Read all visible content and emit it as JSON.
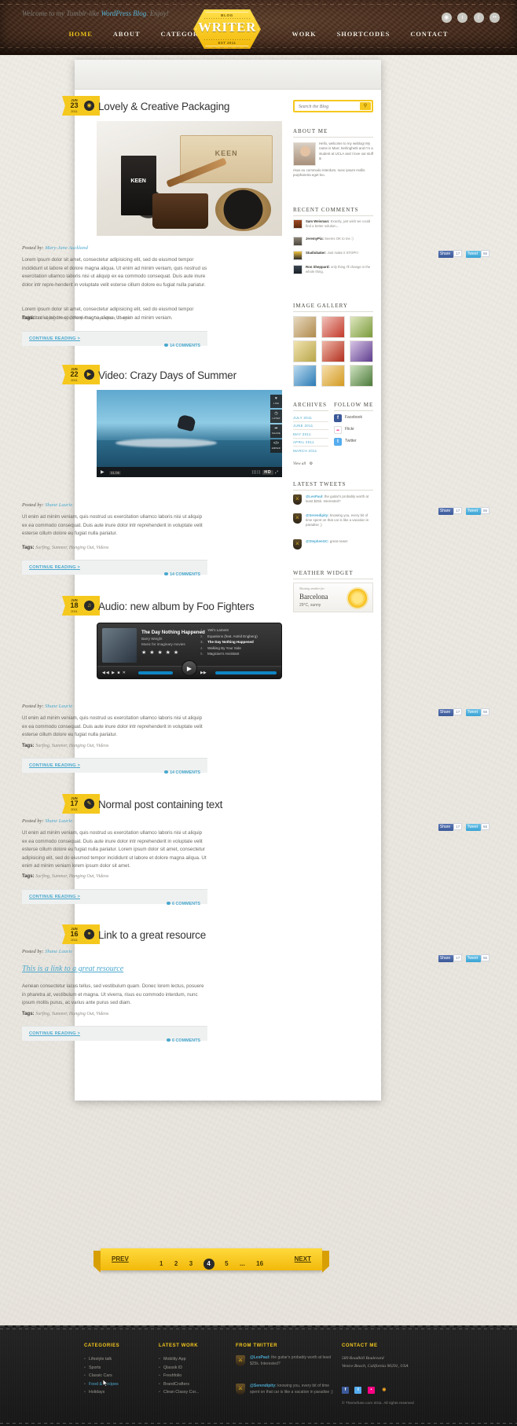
{
  "site": {
    "logo_top": "BLOG",
    "logo_word": "WRITER",
    "logo_est": "EST 2011"
  },
  "nav": {
    "left": [
      {
        "label": "HOME",
        "active": true
      },
      {
        "label": "ABOUT",
        "active": false
      },
      {
        "label": "CATEGORIES",
        "active": false
      }
    ],
    "right": [
      {
        "label": "WORK",
        "active": false
      },
      {
        "label": "SHORTCODES",
        "active": false
      },
      {
        "label": "CONTACT",
        "active": false
      }
    ]
  },
  "welcome": {
    "prefix": "Welcome to my Tumblr-like ",
    "link": "WordPress Blog",
    "suffix": ". Enjoy!",
    "social": [
      {
        "name": "rss-icon",
        "glyph": "◉"
      },
      {
        "name": "twitter-icon",
        "glyph": "t"
      },
      {
        "name": "facebook-icon",
        "glyph": "f"
      },
      {
        "name": "flickr-icon",
        "glyph": "••"
      }
    ]
  },
  "posts": [
    {
      "date": {
        "month": "JUN",
        "day": "23",
        "year": "2011"
      },
      "type_icon": "camera-icon",
      "type_glyph": "◉",
      "title": "Lovely & Creative Packaging",
      "byline_label": "Posted by:",
      "author": "Mary-Jane Auckland",
      "share": {
        "fb": "Share",
        "fb_count": "17",
        "tw": "Tweet",
        "tw_count": "56"
      },
      "paragraphs": [
        "Lorem ipsum dolor sit amet, consectetur adipisicing elit, sed do eiusmod tempor incididunt ut labore et dolore magna aliqua. Ut enim ad minim veniam, quis nostrud us exercitation ullamco laboris nisi ut aliquip ex ea commodo consequat. Duis aute inure dolor intr repre-henderit in voluptate velit esterse cillum dolore eu fugiat nulla pariatur.",
        "Lorem ipsum dolor sit amet, consectetur adipisicing elit, sed do eiusmod tempor incididunt ut labore et dolore magna aliqua. Ut enim ad minim veniam."
      ],
      "tags_label": "Tags:",
      "tags": "Packaging Design,  Portfolios,  Inspiration, Images",
      "continue": "CONTINUE READING >",
      "comments": "14 COMMENTS"
    },
    {
      "date": {
        "month": "JUN",
        "day": "22",
        "year": "2011"
      },
      "type_icon": "video-icon",
      "type_glyph": "▶",
      "title": "Video: Crazy Days of Summer",
      "byline_label": "Posted by:",
      "author": "Shane Laurie",
      "share": {
        "fb": "Share",
        "fb_count": "17",
        "tw": "Tweet",
        "tw_count": "56"
      },
      "video": {
        "time": "01:09",
        "hd": "HD",
        "buttons": [
          {
            "label": "LIKE",
            "glyph": "♥"
          },
          {
            "label": "LATER",
            "glyph": "◷"
          },
          {
            "label": "SHARE",
            "glyph": "➦"
          },
          {
            "label": "EMBED",
            "glyph": "</>"
          }
        ]
      },
      "paragraphs": [
        "Ut enim ad minim veniam, quis nostrud us exercitation ullamco laboris nisi ut aliquip ex ea commodo consequat. Duis aute inure dolor intr reprehenderit in voluptate velit esterse cillum dolore eu fugiat nulla pariatur."
      ],
      "tags_label": "Tags:",
      "tags": "Surfing,  Summer,  Hanging Out, Videos",
      "continue": "CONTINUE READING >",
      "comments": "14 COMMENTS"
    },
    {
      "date": {
        "month": "JUN",
        "day": "18",
        "year": "2011"
      },
      "type_icon": "audio-icon",
      "type_glyph": "♫",
      "title": "Audio: new album by Foo Fighters",
      "byline_label": "Posted by:",
      "author": "Shane Laurie",
      "share": {
        "fb": "Share",
        "fb_count": "17",
        "tw": "Tweet",
        "tw_count": "56"
      },
      "audio": {
        "track_title": "The Day Nothing Happened",
        "artist": "Barry Weight",
        "album": "Music for imaginary movies",
        "stars": "★ ★ ★ ★ ★",
        "transport": "◀◀  ▶  ■  ✕",
        "tracklist": [
          {
            "n": "1.",
            "name": "Yeti's Lament",
            "current": false
          },
          {
            "n": "2.",
            "name": "Equations (feat. Astrid Engberg)",
            "current": false
          },
          {
            "n": "3.",
            "name": "The Day Nothing Happened",
            "current": true
          },
          {
            "n": "4.",
            "name": "Walking By Your Side",
            "current": false
          },
          {
            "n": "5.",
            "name": "Magician's Assistant",
            "current": false
          }
        ]
      },
      "paragraphs": [
        "Ut enim ad minim veniam, quis nostrud us exercitation ullamco laboris nisi ut aliquip ex ea commodo consequat. Duis aute inure dolor intr reprehenderit in voluptate velit esterse cillum dolore eu fugiat nulla pariatur."
      ],
      "tags_label": "Tags:",
      "tags": "Surfing,  Summer,  Hanging Out, Videos",
      "continue": "CONTINUE READING >",
      "comments": "14 COMMENTS"
    },
    {
      "date": {
        "month": "JUN",
        "day": "17",
        "year": "2011"
      },
      "type_icon": "text-icon",
      "type_glyph": "✎",
      "title": "Normal post containing text",
      "byline_label": "Posted by:",
      "author": "Shane Laurie",
      "share": {
        "fb": "Share",
        "fb_count": "17",
        "tw": "Tweet",
        "tw_count": "56"
      },
      "paragraphs": [
        "Ut enim ad minim veniam, quis nostrud us exercitation ullamco laboris nisi ut aliquip ex ea commodo consequat. Duis aute inure dolor intr reprehenderit in voluptate velit esterse cillum dolore eu fugiat nulla pariatur. Lorem ipsum dolor sit amet, consectetur adipisicing elit, sed do eiusmod tempor incididunt ut labore et dolore magna aliqua. Ut enim ad minim veniam lorem ipsum dolor sit amet."
      ],
      "tags_label": "Tags:",
      "tags": "Surfing,  Summer,  Hanging Out, Videos",
      "continue": "CONTINUE READING >",
      "comments": "6 COMMENTS"
    },
    {
      "date": {
        "month": "JUN",
        "day": "16",
        "year": "2011"
      },
      "type_icon": "link-icon",
      "type_glyph": "⚭",
      "title": "Link to a great resource",
      "byline_label": "Posted by:",
      "author": "Shane Laurie",
      "share": {
        "fb": "Share",
        "fb_count": "17",
        "tw": "Tweet",
        "tw_count": "56"
      },
      "link_text": "This is a link to a great resource",
      "paragraphs": [
        "Aenean consectetur lacus tellus, sed vestibulum quam. Donec lorem lectus, posuere in pharetra at, vestibulum et magna. Ut viverra, risus eu commodo interdum, nunc ipsum mollis purus, ac varius ante purus sed diam."
      ],
      "tags_label": "Tags:",
      "tags": "Surfing,  Summer,  Hanging Out, Videos",
      "continue": "CONTINUE READING >",
      "comments": "6 COMMENTS"
    }
  ],
  "sidebar": {
    "search_placeholder": "Search the Blog",
    "search_value": "",
    "search_icon": "search-icon",
    "about": {
      "heading": "ABOUT ME",
      "text_right": "Hello, welcome to my weblog! My name is Marc Serlinghetti and I'm a student at UCLA and I love out stuff &",
      "text_full": "risus eu commodo interdum, nunc ipsum mollis purpharetra eget leo."
    },
    "recent_comments": {
      "heading": "RECENT COMMENTS",
      "items": [
        {
          "author": "Sam Weisman:",
          "text": " Exactly, just wish we could find a better solution..."
        },
        {
          "author": "JeremyPia:",
          "text": " Seems OK to me :)"
        },
        {
          "author": "Studiobaker:",
          "text": " Just make it STOP!!!"
        },
        {
          "author": "Ron Sheppard:",
          "text": " only thing I'll change is the whole thing."
        }
      ]
    },
    "gallery": {
      "heading": "IMAGE GALLERY",
      "count": 9
    },
    "archives": {
      "heading": "ARCHIVES",
      "items": [
        "JULY 2011",
        "JUNE 2011",
        "MAY 2011",
        "APRIL 2011",
        "MARCH 2011"
      ],
      "view_all": "View all"
    },
    "follow": {
      "heading": "FOLLOW ME",
      "items": [
        {
          "label": "Facebook",
          "icon": "facebook-icon",
          "glyph": "f",
          "color": "#3b5998"
        },
        {
          "label": "Flickr",
          "icon": "flickr-icon",
          "glyph": "••",
          "color": "#ff0084"
        },
        {
          "label": "Twitter",
          "icon": "twitter-icon",
          "glyph": "t",
          "color": "#55acee"
        }
      ]
    },
    "tweets": {
      "heading": "LATEST TWEETS",
      "items": [
        {
          "handle": "@LesPaul:",
          "text": " the guitar's probably worth at least $25k. Interested?"
        },
        {
          "handle": "@Serendipity:",
          "text": " knowing you, every bit of time spent on that car is like a vacation in paradise ;)"
        },
        {
          "handle": "@StephenGC:",
          "text": " great news!"
        }
      ]
    },
    "weather": {
      "heading": "WEATHER WIDGET",
      "showing": "Showing weather for:",
      "city": "Barcelona",
      "temp": "29°C, sunny",
      "icon": "sun-icon"
    }
  },
  "pagination": {
    "prev": "PREV",
    "next": "NEXT",
    "pages": [
      "1",
      "2",
      "3",
      "4",
      "5",
      "...",
      "16"
    ],
    "current": "4"
  },
  "footer": {
    "categories": {
      "heading": "CATEGORIES",
      "items": [
        "Lifestyle talk",
        "Sports",
        "Classic Cars",
        "Food & Recipes",
        "Holidays"
      ],
      "highlighted": "Food & Recipes"
    },
    "latest_work": {
      "heading": "LATEST WORK",
      "items": [
        "Mobility App",
        "Qlassik ID",
        "Freshfolio",
        "BrandCrafters",
        "Clean Classy Cor..."
      ]
    },
    "from_twitter": {
      "heading": "FROM TWITTER",
      "items": [
        {
          "handle": "@LesPaul:",
          "text": " the guitar's probably worth at least $25k. Interested?"
        },
        {
          "handle": "@Serendipity:",
          "text": " knowing you, every bit of time spent on that car is like a vacation in paradise ;)"
        }
      ]
    },
    "contact": {
      "heading": "CONTACT ME",
      "address_line1": "589 Roadhill Boulevard",
      "address_line2": "Venice Beach, California 90291, USA",
      "social": [
        {
          "icon": "facebook-icon",
          "glyph": "f",
          "color": "#3b5998"
        },
        {
          "icon": "twitter-icon",
          "glyph": "t",
          "color": "#55acee"
        },
        {
          "icon": "flickr-icon",
          "glyph": "•",
          "color": "#ff0084"
        },
        {
          "icon": "rss-icon",
          "glyph": "◉",
          "color": "#f5a623"
        }
      ],
      "copyright": "© Themefuse.com  2011. All rights reserved"
    }
  },
  "colors": {
    "accent_yellow": "#f5c81e",
    "link_blue": "#4aa8cd",
    "leather": "#45291a",
    "footer_dark": "#1d1d1d"
  }
}
